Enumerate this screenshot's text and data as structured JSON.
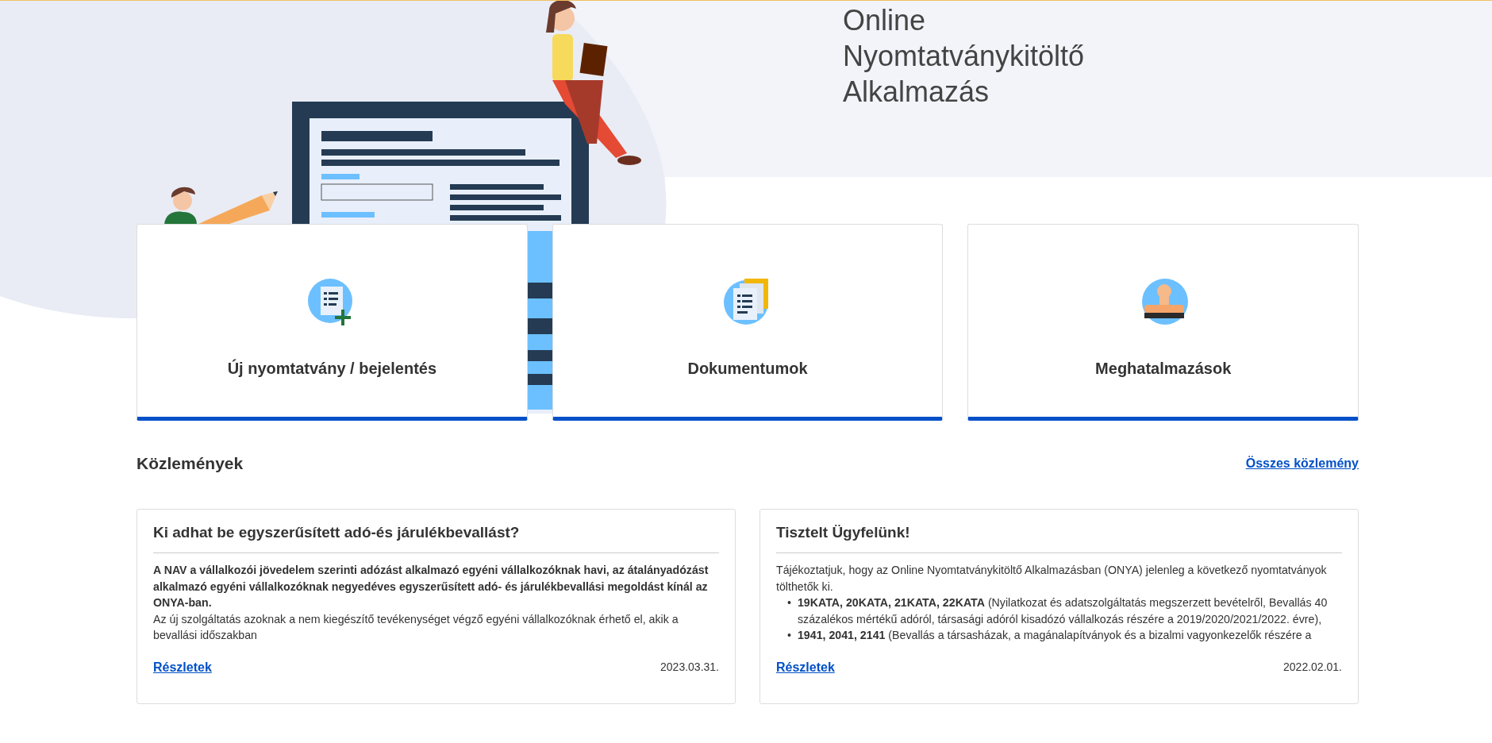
{
  "title_lines": [
    "Online",
    "Nyomtatványkitöltő",
    "Alkalmazás"
  ],
  "tiles": [
    {
      "kind": "new-form",
      "label": "Új nyomtatvány / bejelentés"
    },
    {
      "kind": "documents",
      "label": "Dokumentumok"
    },
    {
      "kind": "authorizations",
      "label": "Meghatalmazások"
    }
  ],
  "announcements": {
    "heading": "Közlemények",
    "all_link": "Összes közlemény",
    "items": [
      {
        "title": "Ki adhat be egyszerűsített adó-és járulékbevallást?",
        "blocks": [
          {
            "kind": "bold",
            "text": "A NAV a vállalkozói jövedelem szerinti adózást alkalmazó egyéni vállalkozóknak havi, az átalányadózást alkalmazó egyéni vállalkozóknak negyedéves egyszerűsített adó- és járulékbevallási megoldást kínál az ONYA-ban."
          },
          {
            "kind": "text",
            "text": "Az új szolgáltatás azoknak a nem kiegészítő tevékenységet végző egyéni vállalkozóknak érhető el, akik a bevallási időszakban"
          }
        ],
        "link": "Részletek",
        "date": "2023.03.31."
      },
      {
        "title": "Tisztelt Ügyfelünk!",
        "blocks": [
          {
            "kind": "text",
            "text": "Tájékoztatjuk, hogy az Online Nyomtatványkitöltő Alkalmazásban (ONYA) jelenleg a következő nyomtatványok tölthetők ki."
          },
          {
            "kind": "bullets",
            "items": [
              {
                "marker": "•",
                "text": "**19KATA, 20KATA, 21KATA, 22KATA** (Nyilatkozat és adatszolgáltatás megszerzett bevételről, Bevallás 40 százalékos mértékű adóról, társasági adóról kisadózó vállalkozás részére a 2019/2020/2021/2022. évre),"
              },
              {
                "marker": "•",
                "text": "**1941, 2041, 2141** (Bevallás a társasházak, a magánalapítványok és a bizalmi vagyonkezelők részére a"
              }
            ]
          }
        ],
        "link": "Részletek",
        "date": "2022.02.01."
      }
    ]
  }
}
